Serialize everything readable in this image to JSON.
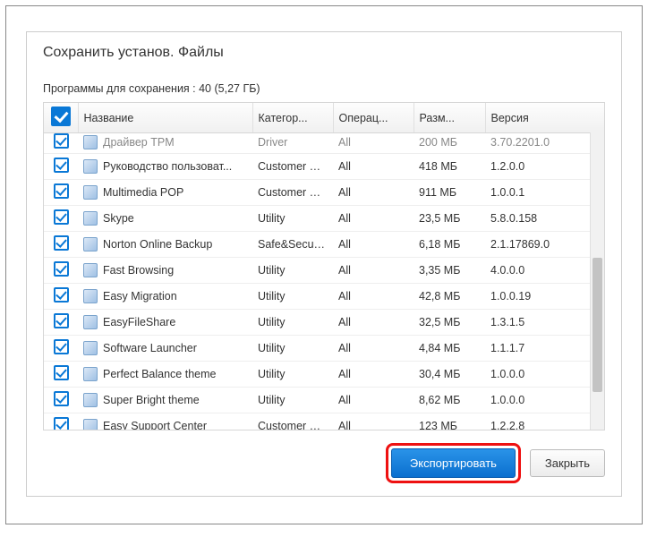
{
  "title": "Сохранить установ. Файлы",
  "subtitle": "Программы для сохранения : 40 (5,27 ГБ)",
  "columns": {
    "name": "Название",
    "category": "Категор...",
    "operation": "Операц...",
    "size": "Разм...",
    "version": "Версия"
  },
  "partial_row": {
    "name": "Драйвер TPM",
    "category": "Driver",
    "operation": "All",
    "size": "200 МБ",
    "version": "3.70.2201.0"
  },
  "rows": [
    {
      "name": "Руководство пользоват...",
      "category": "Customer  Su...",
      "operation": "All",
      "size": "418 МБ",
      "version": "1.2.0.0"
    },
    {
      "name": "Multimedia POP",
      "category": "Customer  Su...",
      "operation": "All",
      "size": "911 МБ",
      "version": "1.0.0.1"
    },
    {
      "name": "Skype",
      "category": "Utility",
      "operation": "All",
      "size": "23,5 МБ",
      "version": "5.8.0.158"
    },
    {
      "name": "Norton Online Backup",
      "category": "Safe&Security",
      "operation": "All",
      "size": "6,18 МБ",
      "version": "2.1.17869.0"
    },
    {
      "name": "Fast Browsing",
      "category": "Utility",
      "operation": "All",
      "size": "3,35 МБ",
      "version": "4.0.0.0"
    },
    {
      "name": "Easy Migration",
      "category": "Utility",
      "operation": "All",
      "size": "42,8 МБ",
      "version": "1.0.0.19"
    },
    {
      "name": "EasyFileShare",
      "category": "Utility",
      "operation": "All",
      "size": "32,5 МБ",
      "version": "1.3.1.5"
    },
    {
      "name": "Software Launcher",
      "category": "Utility",
      "operation": "All",
      "size": "4,84 МБ",
      "version": "1.1.1.7"
    },
    {
      "name": "Perfect Balance theme",
      "category": "Utility",
      "operation": "All",
      "size": "30,4 МБ",
      "version": "1.0.0.0"
    },
    {
      "name": "Super Bright theme",
      "category": "Utility",
      "operation": "All",
      "size": "8,62 МБ",
      "version": "1.0.0.0"
    },
    {
      "name": "Easy Support Center",
      "category": "Customer  Su...",
      "operation": "All",
      "size": "123 МБ",
      "version": "1.2.2.8"
    }
  ],
  "buttons": {
    "export": "Экспортировать",
    "close": "Закрыть"
  }
}
